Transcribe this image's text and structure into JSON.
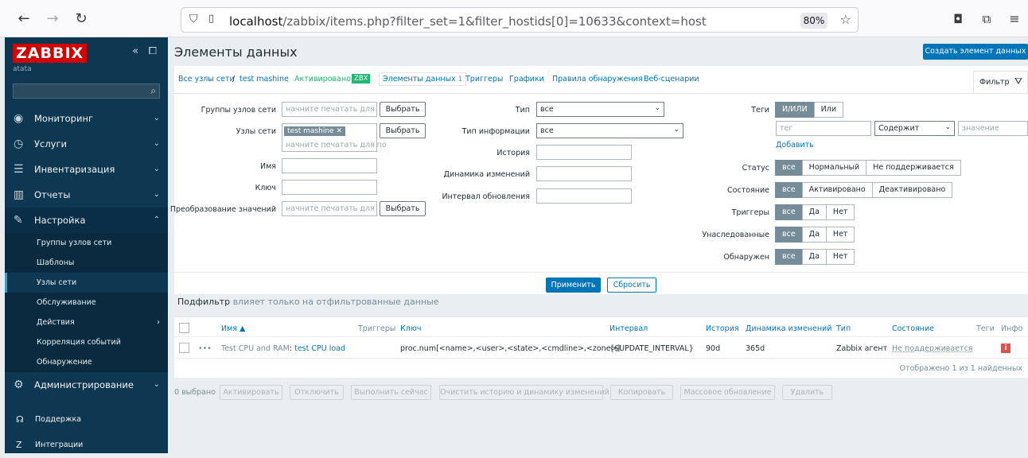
{
  "browser": {
    "url_host": "localhost",
    "url_rest": "/zabbix/items.php?filter_set=1&filter_hostids[0]=10633&context=host",
    "zoom": "80%"
  },
  "sidebar": {
    "logo": "ZABBIX",
    "subtitle": "atata",
    "menu": [
      {
        "label": "Мониторинг",
        "icon": "eye-icon"
      },
      {
        "label": "Услуги",
        "icon": "clock-icon"
      },
      {
        "label": "Инвентаризация",
        "icon": "list-icon"
      },
      {
        "label": "Отчеты",
        "icon": "chart-icon"
      },
      {
        "label": "Настройка",
        "icon": "wrench-icon"
      },
      {
        "label": "Администрирование",
        "icon": "gear-icon"
      }
    ],
    "submenu": [
      "Группы узлов сети",
      "Шаблоны",
      "Узлы сети",
      "Обслуживание",
      "Действия",
      "Корреляция событий",
      "Обнаружение"
    ],
    "bottom": [
      "Поддержка",
      "Интеграции"
    ]
  },
  "page": {
    "title": "Элементы данных",
    "create_button": "Создать элемент данных"
  },
  "tabs": {
    "all_hosts": "Все узлы сети",
    "separator": "/",
    "host": "test mashine",
    "enabled": "Активировано",
    "zbx": "ZBX",
    "items": "Элементы данных",
    "items_count": "1",
    "triggers": "Триггеры",
    "graphs": "Графики",
    "discovery": "Правила обнаружения",
    "web": "Веб-сценарии",
    "filter": "Фильтр"
  },
  "filter": {
    "host_groups_label": "Группы узлов сети",
    "hosts_label": "Узлы сети",
    "name_label": "Имя",
    "key_label": "Ключ",
    "valuemap_label": "Преобразование значений",
    "placeholder_type": "начните печатать для по",
    "select_btn": "Выбрать",
    "host_chip": "test mashine",
    "type_label": "Тип",
    "type_value": "все",
    "info_type_label": "Тип информации",
    "info_type_value": "все",
    "history_label": "История",
    "trends_label": "Динамика изменений",
    "interval_label": "Интервал обновления",
    "tags_label": "Теги",
    "tags_andor": "И/ИЛИ",
    "tags_or": "Или",
    "tag_placeholder": "тег",
    "tag_op": "Содержит",
    "value_placeholder": "значение",
    "add_link": "Добавить",
    "status_label": "Статус",
    "status_opts": [
      "все",
      "Нормальный",
      "Не поддерживается"
    ],
    "state_label": "Состояние",
    "state_opts": [
      "все",
      "Активировано",
      "Деактивировано"
    ],
    "triggers_label": "Триггеры",
    "inherited_label": "Унаследованные",
    "discovered_label": "Обнаружен",
    "yesno_opts": [
      "все",
      "Да",
      "Нет"
    ],
    "apply_btn": "Применить",
    "reset_btn": "Сбросить",
    "subfilter": "Подфильтр",
    "subfilter_note": "влияет только на отфильтрованные данные"
  },
  "table": {
    "headers": [
      "Имя ▲",
      "Триггеры",
      "Ключ",
      "Интервал",
      "История",
      "Динамика изменений",
      "Тип",
      "Состояние",
      "Теги",
      "Инфо"
    ],
    "row": {
      "menu": "•••",
      "template": "Test CPU and RAM",
      "name_sep": ":",
      "name": "test CPU load",
      "key": "proc.num[<name>,<user>,<state>,<cmdline>,<zone>]",
      "interval": "{$UPDATE_INTERVAL}",
      "history": "90d",
      "trends": "365d",
      "type": "Zabbix агент",
      "status": "Не поддерживается",
      "info": "i"
    },
    "footer": "Отображено 1 из 1 найденных"
  },
  "actions": {
    "selected": "0 выбрано",
    "buttons": [
      "Активировать",
      "Отключить",
      "Выполнить сейчас",
      "Очистить историю и динамику изменений",
      "Копировать",
      "Массовое обновление",
      "Удалить"
    ]
  },
  "colors": {
    "accent": "#0275b8",
    "sidebar": "#0e3752",
    "logo": "#d40000",
    "zbx_badge": "#22b573",
    "error": "#d9534f"
  }
}
